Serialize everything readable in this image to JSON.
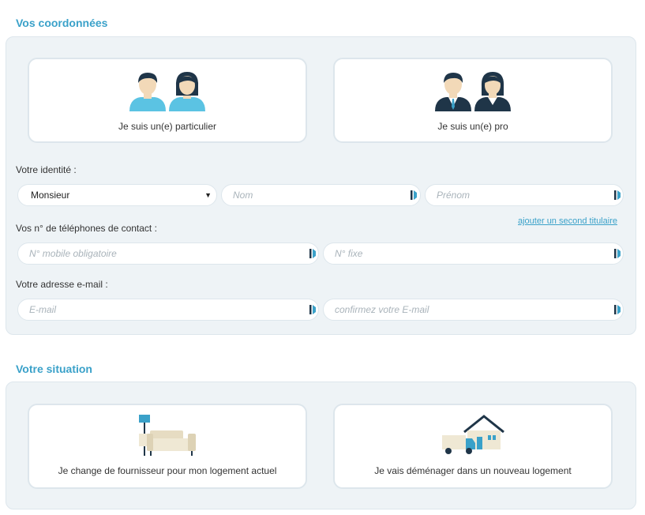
{
  "coordonnees": {
    "title": "Vos coordonnées",
    "profile_cards": [
      {
        "label": "Je suis un(e) particulier",
        "icon": "couple-casual-icon"
      },
      {
        "label": "Je suis un(e) pro",
        "icon": "couple-business-icon"
      }
    ],
    "identity_label": "Votre identité :",
    "civility": {
      "value": "Monsieur"
    },
    "nom": {
      "placeholder": "Nom"
    },
    "prenom": {
      "placeholder": "Prénom"
    },
    "add_holder_link": "ajouter un second titulaire",
    "phone_label": "Vos n° de téléphones de contact :",
    "mobile": {
      "placeholder": "N° mobile obligatoire"
    },
    "fixe": {
      "placeholder": "N° fixe"
    },
    "email_label": "Votre adresse e-mail :",
    "email": {
      "placeholder": "E-mail"
    },
    "email_confirm": {
      "placeholder": "confirmez votre E-mail"
    }
  },
  "situation": {
    "title": "Votre situation",
    "cards": [
      {
        "label": "Je change de fournisseur pour mon logement actuel",
        "icon": "sofa-lamp-icon"
      },
      {
        "label": "Je vais déménager dans un nouveau logement",
        "icon": "moving-truck-house-icon"
      }
    ]
  },
  "colors": {
    "accent": "#3aa1c9",
    "panel_bg": "#eef3f6",
    "border": "#dde6ec",
    "dark": "#1f3548"
  }
}
